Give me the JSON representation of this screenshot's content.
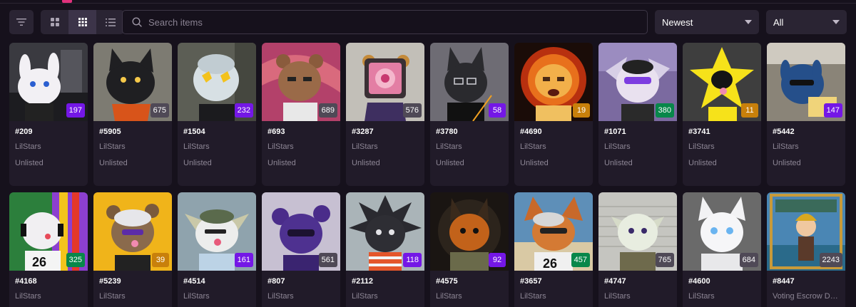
{
  "toolbar": {
    "search_placeholder": "Search items",
    "sort_value": "Newest",
    "status_value": "All",
    "icons": {
      "filter": "filter-icon",
      "grid_large": "grid-large-icon",
      "grid_small": "grid-small-icon",
      "list": "list-icon",
      "search": "search-icon",
      "chevron": "chevron-down-icon"
    }
  },
  "colors": {
    "rank_purple": "#7417e6",
    "rank_gray": "#4f4956",
    "rank_green": "#08874a",
    "rank_orange": "#c8800b",
    "accent": "#e1317c"
  },
  "items": [
    {
      "id": "#209",
      "collection": "LilStars",
      "status": "Unlisted",
      "rank": "197",
      "rank_color": "purple"
    },
    {
      "id": "#5905",
      "collection": "LilStars",
      "status": "Unlisted",
      "rank": "675",
      "rank_color": "gray"
    },
    {
      "id": "#1504",
      "collection": "LilStars",
      "status": "Unlisted",
      "rank": "232",
      "rank_color": "purple"
    },
    {
      "id": "#693",
      "collection": "LilStars",
      "status": "Unlisted",
      "rank": "689",
      "rank_color": "gray"
    },
    {
      "id": "#3287",
      "collection": "LilStars",
      "status": "Unlisted",
      "rank": "576",
      "rank_color": "gray"
    },
    {
      "id": "#3780",
      "collection": "LilStars",
      "status": "Unlisted",
      "rank": "58",
      "rank_color": "purple"
    },
    {
      "id": "#4690",
      "collection": "LilStars",
      "status": "Unlisted",
      "rank": "19",
      "rank_color": "orange"
    },
    {
      "id": "#1071",
      "collection": "LilStars",
      "status": "Unlisted",
      "rank": "380",
      "rank_color": "green"
    },
    {
      "id": "#3741",
      "collection": "LilStars",
      "status": "Unlisted",
      "rank": "11",
      "rank_color": "orange"
    },
    {
      "id": "#5442",
      "collection": "LilStars",
      "status": "Unlisted",
      "rank": "147",
      "rank_color": "purple"
    },
    {
      "id": "#4168",
      "collection": "LilStars",
      "status": "",
      "rank": "325",
      "rank_color": "green"
    },
    {
      "id": "#5239",
      "collection": "LilStars",
      "status": "",
      "rank": "39",
      "rank_color": "orange"
    },
    {
      "id": "#4514",
      "collection": "LilStars",
      "status": "",
      "rank": "161",
      "rank_color": "purple"
    },
    {
      "id": "#807",
      "collection": "LilStars",
      "status": "",
      "rank": "561",
      "rank_color": "gray"
    },
    {
      "id": "#2112",
      "collection": "LilStars",
      "status": "",
      "rank": "118",
      "rank_color": "purple"
    },
    {
      "id": "#4575",
      "collection": "LilStars",
      "status": "",
      "rank": "92",
      "rank_color": "purple"
    },
    {
      "id": "#3657",
      "collection": "LilStars",
      "status": "",
      "rank": "457",
      "rank_color": "green"
    },
    {
      "id": "#4747",
      "collection": "LilStars",
      "status": "",
      "rank": "765",
      "rank_color": "gray"
    },
    {
      "id": "#4600",
      "collection": "LilStars",
      "status": "",
      "rank": "684",
      "rank_color": "gray"
    },
    {
      "id": "#8447",
      "collection": "Voting Escrow DU...",
      "status": "",
      "rank": "2243",
      "rank_color": "gray"
    }
  ]
}
